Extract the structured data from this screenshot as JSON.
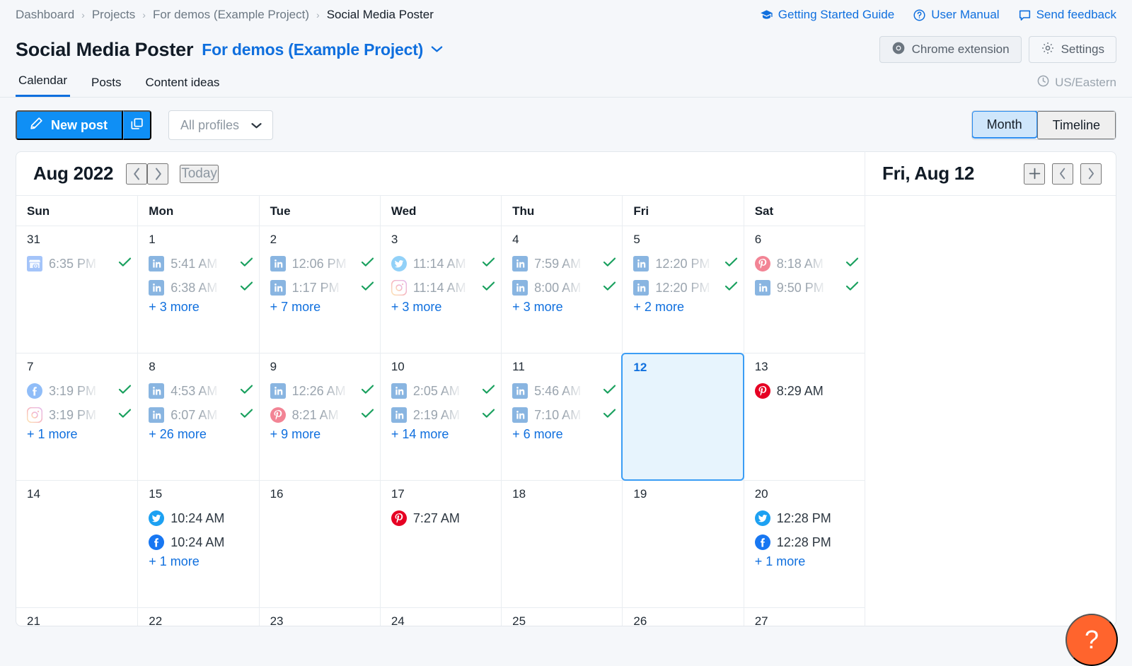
{
  "breadcrumb": {
    "items": [
      {
        "label": "Dashboard",
        "active": false
      },
      {
        "label": "Projects",
        "active": false
      },
      {
        "label": "For demos (Example Project)",
        "active": false
      },
      {
        "label": "Social Media Poster",
        "active": true
      }
    ],
    "separator": "›"
  },
  "top_links": [
    {
      "label": "Getting Started Guide",
      "icon": "graduation-cap-icon"
    },
    {
      "label": "User Manual",
      "icon": "question-circle-icon"
    },
    {
      "label": "Send feedback",
      "icon": "speech-bubble-icon"
    }
  ],
  "title": {
    "name": "Social Media Poster",
    "project": "For demos (Example Project)",
    "caret": "⌄"
  },
  "title_actions": {
    "chrome_extension": "Chrome extension",
    "settings": "Settings"
  },
  "tabs": [
    {
      "label": "Calendar",
      "selected": true
    },
    {
      "label": "Posts",
      "selected": false
    },
    {
      "label": "Content ideas",
      "selected": false
    }
  ],
  "timezone": "US/Eastern",
  "toolbar": {
    "new_post": "New post",
    "duplicate_icon": "duplicate-icon",
    "profiles_placeholder": "All profiles",
    "view_month": "Month",
    "view_timeline": "Timeline",
    "view_selected": "Month"
  },
  "calendar": {
    "month_label": "Aug 2022",
    "prev": "‹",
    "next": "›",
    "today": "Today",
    "day_names": [
      "Sun",
      "Mon",
      "Tue",
      "Wed",
      "Thu",
      "Fri",
      "Sat"
    ],
    "weeks": [
      [
        {
          "day": "31",
          "other_month": true,
          "events": [
            {
              "network": "google-business-icon",
              "time": "6:35 PM",
              "state": "past",
              "checked": true
            }
          ],
          "more": ""
        },
        {
          "day": "1",
          "events": [
            {
              "network": "linkedin-icon",
              "time": "5:41 AM",
              "state": "past",
              "checked": true
            },
            {
              "network": "linkedin-icon",
              "time": "6:38 AM",
              "state": "past",
              "checked": true
            }
          ],
          "more": "+ 3 more"
        },
        {
          "day": "2",
          "events": [
            {
              "network": "linkedin-icon",
              "time": "12:06 PM",
              "state": "past",
              "checked": true
            },
            {
              "network": "linkedin-icon",
              "time": "1:17 PM",
              "state": "past",
              "checked": true
            }
          ],
          "more": "+ 7 more"
        },
        {
          "day": "3",
          "events": [
            {
              "network": "twitter-icon",
              "time": "11:14 AM",
              "state": "past",
              "checked": true
            },
            {
              "network": "instagram-icon",
              "time": "11:14 AM",
              "state": "past",
              "checked": true
            }
          ],
          "more": "+ 3 more"
        },
        {
          "day": "4",
          "events": [
            {
              "network": "linkedin-icon",
              "time": "7:59 AM",
              "state": "past",
              "checked": true
            },
            {
              "network": "linkedin-icon",
              "time": "8:00 AM",
              "state": "past",
              "checked": true
            }
          ],
          "more": "+ 3 more"
        },
        {
          "day": "5",
          "events": [
            {
              "network": "linkedin-icon",
              "time": "12:20 PM",
              "state": "past",
              "checked": true
            },
            {
              "network": "linkedin-icon",
              "time": "12:20 PM",
              "state": "past",
              "checked": true
            }
          ],
          "more": "+ 2 more"
        },
        {
          "day": "6",
          "events": [
            {
              "network": "pinterest-icon",
              "time": "8:18 AM",
              "state": "past",
              "checked": true
            },
            {
              "network": "linkedin-icon",
              "time": "9:50 PM",
              "state": "past",
              "checked": true
            }
          ],
          "more": ""
        }
      ],
      [
        {
          "day": "7",
          "events": [
            {
              "network": "facebook-icon",
              "time": "3:19 PM",
              "state": "past",
              "checked": true
            },
            {
              "network": "instagram-icon",
              "time": "3:19 PM",
              "state": "past",
              "checked": true
            }
          ],
          "more": "+ 1 more"
        },
        {
          "day": "8",
          "events": [
            {
              "network": "linkedin-icon",
              "time": "4:53 AM",
              "state": "past",
              "checked": true
            },
            {
              "network": "linkedin-icon",
              "time": "6:07 AM",
              "state": "past",
              "checked": true
            }
          ],
          "more": "+ 26 more"
        },
        {
          "day": "9",
          "events": [
            {
              "network": "linkedin-icon",
              "time": "12:26 AM",
              "state": "past",
              "checked": true
            },
            {
              "network": "pinterest-icon",
              "time": "8:21 AM",
              "state": "past",
              "checked": true
            }
          ],
          "more": "+ 9 more"
        },
        {
          "day": "10",
          "events": [
            {
              "network": "linkedin-icon",
              "time": "2:05 AM",
              "state": "past",
              "checked": true
            },
            {
              "network": "linkedin-icon",
              "time": "2:19 AM",
              "state": "past",
              "checked": true
            }
          ],
          "more": "+ 14 more"
        },
        {
          "day": "11",
          "events": [
            {
              "network": "linkedin-icon",
              "time": "5:46 AM",
              "state": "past",
              "checked": true
            },
            {
              "network": "linkedin-icon",
              "time": "7:10 AM",
              "state": "past",
              "checked": true
            }
          ],
          "more": "+ 6 more"
        },
        {
          "day": "12",
          "selected": true,
          "events": [],
          "more": ""
        },
        {
          "day": "13",
          "events": [
            {
              "network": "pinterest-icon",
              "time": "8:29 AM",
              "state": "future",
              "checked": false
            }
          ],
          "more": ""
        }
      ],
      [
        {
          "day": "14",
          "events": [],
          "more": ""
        },
        {
          "day": "15",
          "events": [
            {
              "network": "twitter-icon",
              "time": "10:24 AM",
              "state": "future",
              "checked": false
            },
            {
              "network": "facebook-icon",
              "time": "10:24 AM",
              "state": "future",
              "checked": false
            }
          ],
          "more": "+ 1 more"
        },
        {
          "day": "16",
          "events": [],
          "more": ""
        },
        {
          "day": "17",
          "events": [
            {
              "network": "pinterest-icon",
              "time": "7:27 AM",
              "state": "future",
              "checked": false
            }
          ],
          "more": ""
        },
        {
          "day": "18",
          "events": [],
          "more": ""
        },
        {
          "day": "19",
          "events": [],
          "more": ""
        },
        {
          "day": "20",
          "events": [
            {
              "network": "twitter-icon",
              "time": "12:28 PM",
              "state": "future",
              "checked": false
            },
            {
              "network": "facebook-icon",
              "time": "12:28 PM",
              "state": "future",
              "checked": false
            }
          ],
          "more": "+ 1 more"
        }
      ],
      [
        {
          "day": "21",
          "events": [],
          "more": ""
        },
        {
          "day": "22",
          "events": [],
          "more": ""
        },
        {
          "day": "23",
          "events": [],
          "more": ""
        },
        {
          "day": "24",
          "events": [],
          "more": ""
        },
        {
          "day": "25",
          "events": [],
          "more": ""
        },
        {
          "day": "26",
          "events": [],
          "more": ""
        },
        {
          "day": "27",
          "events": [],
          "more": ""
        }
      ]
    ]
  },
  "day_panel": {
    "title": "Fri, Aug 12",
    "add": "+",
    "prev": "‹",
    "next": "›"
  },
  "help_button": "?",
  "colors": {
    "accent": "#0f6fde",
    "primary_button": "#0f8ff5",
    "check": "#19a05e",
    "help_fab": "#ff642d",
    "selected_cell_bg": "#e7f4fd",
    "selected_cell_border": "#3b9df5"
  }
}
